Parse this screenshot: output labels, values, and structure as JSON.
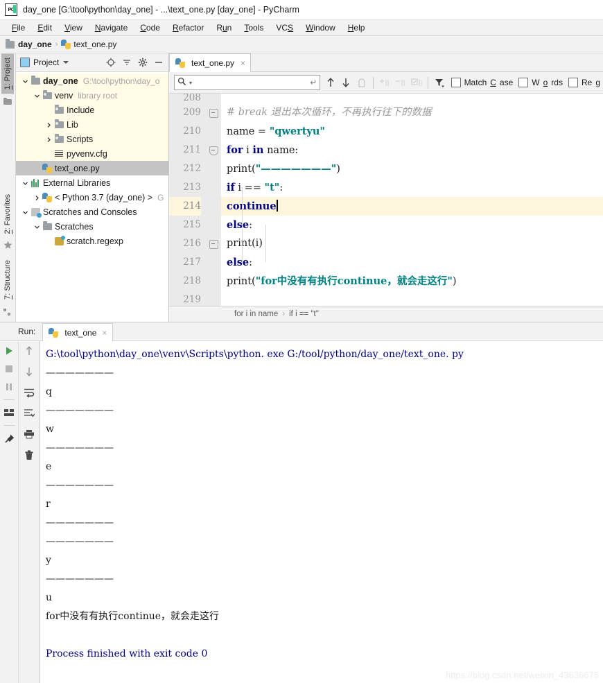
{
  "window": {
    "title": "day_one [G:\\tool\\python\\day_one] - ...\\text_one.py [day_one] - PyCharm",
    "logo_text": "PC"
  },
  "menubar": {
    "items": [
      {
        "pre": "",
        "mn": "F",
        "post": "ile"
      },
      {
        "pre": "",
        "mn": "E",
        "post": "dit"
      },
      {
        "pre": "",
        "mn": "V",
        "post": "iew"
      },
      {
        "pre": "",
        "mn": "N",
        "post": "avigate"
      },
      {
        "pre": "",
        "mn": "C",
        "post": "ode"
      },
      {
        "pre": "",
        "mn": "R",
        "post": "efactor"
      },
      {
        "pre": "R",
        "mn": "u",
        "post": "n"
      },
      {
        "pre": "",
        "mn": "T",
        "post": "ools"
      },
      {
        "pre": "VC",
        "mn": "S",
        "post": ""
      },
      {
        "pre": "",
        "mn": "W",
        "post": "indow"
      },
      {
        "pre": "",
        "mn": "H",
        "post": "elp"
      }
    ]
  },
  "breadcrumb": {
    "project": "day_one",
    "file": "text_one.py",
    "separator": "›"
  },
  "leftrail": {
    "project_tab_pre": "",
    "project_tab_mn": "1",
    "project_tab_post": ": Project",
    "favorites_tab_pre": "",
    "favorites_tab_mn": "2",
    "favorites_tab_post": ": Favorites",
    "structure_tab_pre": "",
    "structure_tab_mn": "7",
    "structure_tab_post": ": Structure"
  },
  "project_panel": {
    "title": "Project",
    "tree": [
      {
        "label": "day_one",
        "path": "G:\\tool\\python\\day_o",
        "indent": 0,
        "twisty": "down",
        "icon": "folder-icon",
        "bold": true,
        "state": "highlight"
      },
      {
        "label": "venv",
        "path": "library root",
        "indent": 1,
        "twisty": "down",
        "icon": "folder-lib-icon",
        "bold": false,
        "state": "highlight"
      },
      {
        "label": "Include",
        "path": "",
        "indent": 2,
        "twisty": "none",
        "icon": "folder-lib-icon",
        "bold": false,
        "state": "highlight"
      },
      {
        "label": "Lib",
        "path": "",
        "indent": 2,
        "twisty": "right",
        "icon": "folder-lib-icon",
        "bold": false,
        "state": "highlight"
      },
      {
        "label": "Scripts",
        "path": "",
        "indent": 2,
        "twisty": "right",
        "icon": "folder-lib-icon",
        "bold": false,
        "state": "highlight"
      },
      {
        "label": "pyvenv.cfg",
        "path": "",
        "indent": 2,
        "twisty": "none",
        "icon": "config-file-icon",
        "bold": false,
        "state": "highlight"
      },
      {
        "label": "text_one.py",
        "path": "",
        "indent": 1,
        "twisty": "none",
        "icon": "python-file-icon",
        "bold": false,
        "state": "selected"
      },
      {
        "label": "External Libraries",
        "path": "",
        "indent": 0,
        "twisty": "down",
        "icon": "external-libraries-icon",
        "bold": false,
        "state": "normal"
      },
      {
        "label": "< Python 3.7 (day_one) >",
        "path": "G",
        "indent": 1,
        "twisty": "right",
        "icon": "python-interpreter-icon",
        "bold": false,
        "state": "normal"
      },
      {
        "label": "Scratches and Consoles",
        "path": "",
        "indent": 0,
        "twisty": "down",
        "icon": "scratches-icon",
        "bold": false,
        "state": "normal"
      },
      {
        "label": "Scratches",
        "path": "",
        "indent": 1,
        "twisty": "down",
        "icon": "folder-icon",
        "bold": false,
        "state": "normal"
      },
      {
        "label": "scratch.regexp",
        "path": "",
        "indent": 2,
        "twisty": "none",
        "icon": "regexp-file-icon",
        "bold": false,
        "state": "normal"
      }
    ]
  },
  "editor": {
    "tab_label": "text_one.py",
    "tab_close": "×",
    "find": {
      "value": "",
      "enter_glyph": "↵",
      "match_case_pre": "Match ",
      "match_case_mn": "C",
      "match_case_post": "ase",
      "words_pre": "W",
      "words_mn": "o",
      "words_post": "rds",
      "regex_pre": "Re",
      "regex_mn": "g",
      "regex_post": ""
    },
    "first_line_number": 208,
    "current_line": 214,
    "lines": [
      {
        "n": 208,
        "partial": true,
        "tokens": []
      },
      {
        "n": 209,
        "fold": "minus",
        "tokens": [
          {
            "t": "#  break  退出本次循环，不再执行往下的数据",
            "c": "cmt"
          }
        ]
      },
      {
        "n": 210,
        "tokens": [
          {
            "t": "name = ",
            "c": "fn"
          },
          {
            "t": "\"qwertyu\"",
            "c": "str"
          }
        ]
      },
      {
        "n": 211,
        "fold": "arrow",
        "tokens": [
          {
            "t": "for",
            "c": "kw"
          },
          {
            "t": " i ",
            "c": "fn"
          },
          {
            "t": "in",
            "c": "kw"
          },
          {
            "t": " name:",
            "c": "fn"
          }
        ]
      },
      {
        "n": 212,
        "tokens": [
          {
            "t": "    print(",
            "c": "fn"
          },
          {
            "t": "\"———————\"",
            "c": "str"
          },
          {
            "t": ")",
            "c": "fn"
          }
        ]
      },
      {
        "n": 213,
        "tokens": [
          {
            "t": "    ",
            "c": "fn"
          },
          {
            "t": "if",
            "c": "kw"
          },
          {
            "t": " i == ",
            "c": "fn"
          },
          {
            "t": "\"t\"",
            "c": "str"
          },
          {
            "t": ":",
            "c": "fn"
          }
        ]
      },
      {
        "n": 214,
        "current": true,
        "tokens": [
          {
            "t": "        ",
            "c": "fn"
          },
          {
            "t": "continue",
            "c": "kw"
          }
        ],
        "cursor": true
      },
      {
        "n": 215,
        "tokens": [
          {
            "t": "    ",
            "c": "fn"
          },
          {
            "t": "else",
            "c": "kw"
          },
          {
            "t": ":",
            "c": "fn"
          }
        ]
      },
      {
        "n": 216,
        "fold": "minus",
        "tokens": [
          {
            "t": "        print(i)",
            "c": "fn"
          }
        ]
      },
      {
        "n": 217,
        "tokens": [
          {
            "t": "else",
            "c": "kw"
          },
          {
            "t": ":",
            "c": "fn"
          }
        ]
      },
      {
        "n": 218,
        "tokens": [
          {
            "t": "    print(",
            "c": "fn"
          },
          {
            "t": "\"for中没有有执行continue，就会走这行\"",
            "c": "str"
          },
          {
            "t": ")",
            "c": "fn"
          }
        ]
      },
      {
        "n": 219,
        "tokens": []
      }
    ],
    "status_breadcrumb": [
      "for i in name",
      "if i == \"t\""
    ],
    "status_breadcrumb_sep": "›"
  },
  "run_panel": {
    "run_label": "Run:",
    "tab_label": "text_one",
    "tab_close": "×",
    "left_tools": [
      "run-icon",
      "stop-icon",
      "pause-icon",
      "layout-icon",
      "pin-icon"
    ],
    "right_tools": [
      "arrow-up-icon",
      "arrow-down-icon",
      "soft-wrap-icon",
      "scroll-to-end-icon",
      "print-icon",
      "trash-icon"
    ],
    "console": [
      {
        "text": "G:\\tool\\python\\day_one\\venv\\Scripts\\python. exe G:/tool/python/day_one/text_one. py",
        "cls": "co-cmd"
      },
      {
        "text": "———————",
        "cls": "co-out"
      },
      {
        "text": "q",
        "cls": "co-out"
      },
      {
        "text": "———————",
        "cls": "co-out"
      },
      {
        "text": "w",
        "cls": "co-out"
      },
      {
        "text": "———————",
        "cls": "co-out"
      },
      {
        "text": "e",
        "cls": "co-out"
      },
      {
        "text": "———————",
        "cls": "co-out"
      },
      {
        "text": "r",
        "cls": "co-out"
      },
      {
        "text": "———————",
        "cls": "co-out"
      },
      {
        "text": "———————",
        "cls": "co-out"
      },
      {
        "text": "y",
        "cls": "co-out"
      },
      {
        "text": "———————",
        "cls": "co-out"
      },
      {
        "text": "u",
        "cls": "co-out"
      },
      {
        "text": "for中没有有执行continue，就会走这行",
        "cls": "co-out"
      },
      {
        "text": "",
        "cls": "co-out"
      },
      {
        "text": "Process finished with exit code 0",
        "cls": "co-done"
      }
    ],
    "watermark": "https://blog.csdn.net/weixin_43636675"
  }
}
